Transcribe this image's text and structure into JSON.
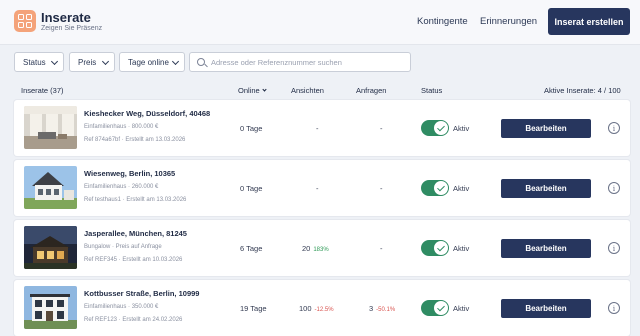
{
  "header": {
    "title": "Inserate",
    "subtitle": "Zeigen Sie Präsenz",
    "nav": [
      "Kontingente",
      "Erinnerungen"
    ],
    "create_button": "Inserat erstellen",
    "logo_icon": "grid-icon"
  },
  "filters": {
    "status": "Status",
    "preis": "Preis",
    "tage_online": "Tage online",
    "search_placeholder": "Adresse oder Referenznummer suchen"
  },
  "table": {
    "columns": {
      "inserate": "Inserate (37)",
      "online": "Online",
      "ansichten": "Ansichten",
      "anfragen": "Anfragen",
      "status": "Status",
      "aktive": "Aktive Inserate: 4 / 100"
    },
    "rows": [
      {
        "address": "Kieshecker Weg, Düsseldorf, 40468",
        "type_price": "Einfamilienhaus · 800.000 €",
        "ref_created": "Ref 874a67bf · Erstellt am 13.03.2026",
        "online": "0 Tage",
        "views": "-",
        "views_pct": "",
        "inquiries": "-",
        "inquiries_pct": "",
        "status": "Aktiv",
        "edit": "Bearbeiten",
        "info": "i",
        "thumb": "interior"
      },
      {
        "address": "Wiesenweg, Berlin, 10365",
        "type_price": "Einfamilienhaus · 260.000 €",
        "ref_created": "Ref testhaus1 · Erstellt am 13.03.2026",
        "online": "0 Tage",
        "views": "-",
        "views_pct": "",
        "inquiries": "-",
        "inquiries_pct": "",
        "status": "Aktiv",
        "edit": "Bearbeiten",
        "info": "i",
        "thumb": "house-white"
      },
      {
        "address": "Jasperallee, München, 81245",
        "type_price": "Bungalow · Preis auf Anfrage",
        "ref_created": "Ref REF345 · Erstellt am 10.03.2026",
        "online": "6 Tage",
        "views": "20",
        "views_pct": "183%",
        "inquiries": "-",
        "inquiries_pct": "",
        "status": "Aktiv",
        "edit": "Bearbeiten",
        "info": "i",
        "thumb": "house-dusk"
      },
      {
        "address": "Kottbusser Straße, Berlin, 10999",
        "type_price": "Einfamilienhaus · 350.000 €",
        "ref_created": "Ref REF123 · Erstellt am 24.02.2026",
        "online": "19 Tage",
        "views": "100",
        "views_pct": "-12.5%",
        "inquiries": "3",
        "inquiries_pct": "-50.1%",
        "status": "Aktiv",
        "edit": "Bearbeiten",
        "info": "i",
        "thumb": "house-modern"
      }
    ]
  },
  "colors": {
    "accent": "#27365e",
    "toggle": "#2f8c63",
    "logo": "#f4a37a",
    "positive": "#2e9a56",
    "negative": "#d9534f"
  }
}
